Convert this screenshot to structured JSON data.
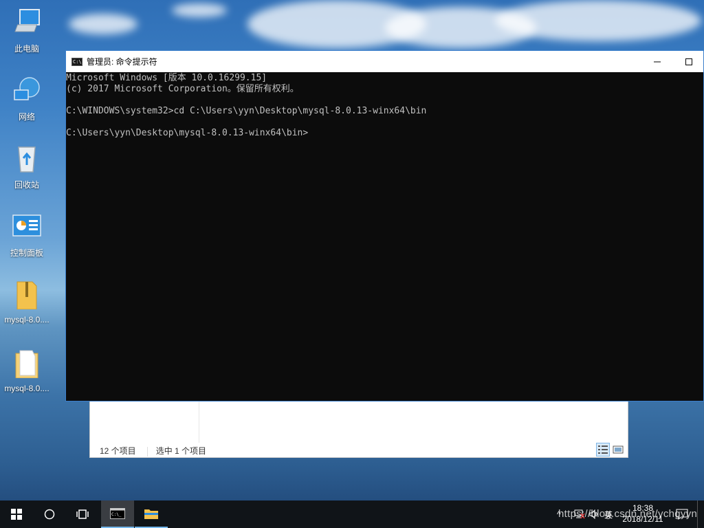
{
  "desktop": {
    "icons": [
      {
        "label": "此电脑",
        "icon": "computer-icon"
      },
      {
        "label": "网络",
        "icon": "network-icon"
      },
      {
        "label": "回收站",
        "icon": "recycle-bin-icon"
      },
      {
        "label": "控制面板",
        "icon": "control-panel-icon"
      },
      {
        "label": "mysql-8.0....",
        "icon": "zip-folder-icon"
      },
      {
        "label": "mysql-8.0....",
        "icon": "folder-icon"
      }
    ]
  },
  "explorer": {
    "status_items": "12 个项目",
    "status_selected": "选中 1 个项目"
  },
  "cmd": {
    "title": "管理员: 命令提示符",
    "minimize": "—",
    "maximize": "☐",
    "lines": [
      "Microsoft Windows [版本 10.0.16299.15]",
      "(c) 2017 Microsoft Corporation。保留所有权利。",
      "",
      "C:\\WINDOWS\\system32>cd C:\\Users\\yyn\\Desktop\\mysql-8.0.13-winx64\\bin",
      "",
      "C:\\Users\\yyn\\Desktop\\mysql-8.0.13-winx64\\bin>"
    ]
  },
  "taskbar": {
    "tray_chevron": "^",
    "tray_lang": "英",
    "time": "18:38",
    "date": "2018/12/11",
    "watermark": "https://blog.csdn.net/ychgyyn"
  },
  "colors": {
    "console_bg": "#0c0c0c",
    "console_text": "#c0c0c0",
    "taskbar_bg": "#101418",
    "accent": "#76b9ed"
  }
}
